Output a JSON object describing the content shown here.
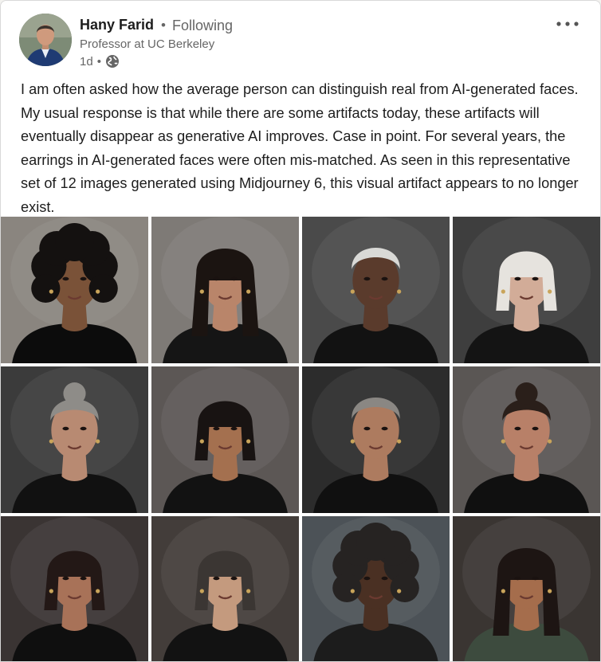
{
  "post": {
    "author": {
      "name": "Hany Farid",
      "separator": "•",
      "follow_status": "Following",
      "headline": "Professor at UC Berkeley",
      "timestamp": "1d",
      "timestamp_separator": "•",
      "visibility_icon": "globe-icon",
      "avatar_icon": "profile-photo"
    },
    "more_icon": "ellipsis-icon",
    "text": "I am often asked how the average person can distinguish real from AI-generated faces. My usual response is that while there are some artifacts today, these artifacts will eventually disappear as generative AI improves. Case in point. For several years, the earrings in AI-generated faces were often mis-matched. As seen in this representative set of 12 images generated using Midjourney 6, this visual artifact appears to no longer exist.",
    "images": [
      {
        "subject": "young woman with curly black hair",
        "bg": "#8a857f",
        "skin": "#7a5238",
        "hair": "#141110",
        "cloth": "#0c0c0c",
        "hairStyle": "curly"
      },
      {
        "subject": "young woman with long dark hair",
        "bg": "#7e7a76",
        "skin": "#b9856a",
        "hair": "#1b1411",
        "cloth": "#151515",
        "hairStyle": "long"
      },
      {
        "subject": "older woman with short grey hair, smiling",
        "bg": "#4a4a4a",
        "skin": "#5a3b2c",
        "hair": "#d9d9d6",
        "cloth": "#121212",
        "hairStyle": "short"
      },
      {
        "subject": "older woman with white bob",
        "bg": "#3e3e3e",
        "skin": "#d2ac98",
        "hair": "#e6e3de",
        "cloth": "#141414",
        "hairStyle": "bob"
      },
      {
        "subject": "older woman with grey updo",
        "bg": "#3b3b3b",
        "skin": "#b88a72",
        "hair": "#8e8c88",
        "cloth": "#111111",
        "hairStyle": "updo"
      },
      {
        "subject": "woman with dark shoulder-length hair",
        "bg": "#5c5755",
        "skin": "#a4704f",
        "hair": "#181312",
        "cloth": "#121212",
        "hairStyle": "bob"
      },
      {
        "subject": "older woman with grey wavy hair",
        "bg": "#2c2c2c",
        "skin": "#ad7b5f",
        "hair": "#8a8783",
        "cloth": "#101010",
        "hairStyle": "short"
      },
      {
        "subject": "woman with dark hair pulled back",
        "bg": "#5a5654",
        "skin": "#b88068",
        "hair": "#2a1f1a",
        "cloth": "#101010",
        "hairStyle": "updo"
      },
      {
        "subject": "woman with dark wavy hair",
        "bg": "#3a3433",
        "skin": "#a87258",
        "hair": "#231816",
        "cloth": "#0f0f0f",
        "hairStyle": "bob"
      },
      {
        "subject": "woman with greying bob",
        "bg": "#433d3a",
        "skin": "#c49a7e",
        "hair": "#3b3633",
        "cloth": "#121212",
        "hairStyle": "bob"
      },
      {
        "subject": "woman with short curly grey-black hair",
        "bg": "#4c5257",
        "skin": "#4a3023",
        "hair": "#262322",
        "cloth": "#1c1c1c",
        "hairStyle": "curly"
      },
      {
        "subject": "woman with long dark wavy hair",
        "bg": "#3a3532",
        "skin": "#a56d4c",
        "hair": "#1d1513",
        "cloth": "#3d4b3e",
        "hairStyle": "long"
      }
    ]
  }
}
